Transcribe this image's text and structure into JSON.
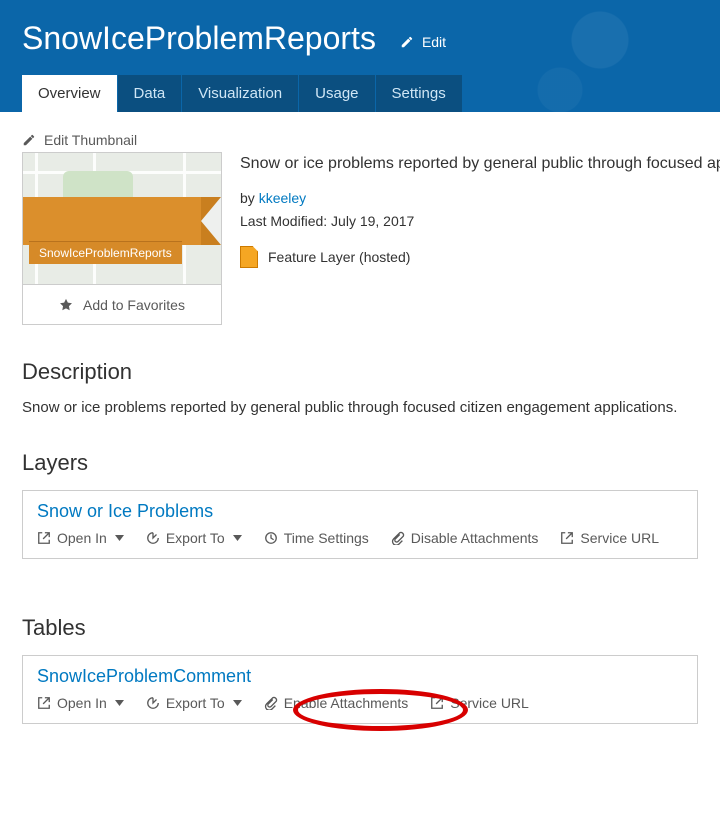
{
  "header": {
    "title": "SnowIceProblemReports",
    "edit_label": "Edit"
  },
  "tabs": [
    "Overview",
    "Data",
    "Visualization",
    "Usage",
    "Settings"
  ],
  "active_tab": "Overview",
  "thumbnail": {
    "edit_label": "Edit Thumbnail",
    "ribbon_text": "SnowIceProblemReports",
    "favorites_label": "Add to Favorites"
  },
  "summary": {
    "text": "Snow or ice problems reported by general public through focused applications.",
    "by_prefix": "by ",
    "author": "kkeeley",
    "last_modified_label": "Last Modified: July 19, 2017",
    "item_type": "Feature Layer (hosted)"
  },
  "description": {
    "heading": "Description",
    "body": "Snow or ice problems reported by general public through focused citizen engagement applications."
  },
  "layers": {
    "heading": "Layers",
    "items": [
      {
        "name": "Snow or Ice Problems",
        "actions": {
          "open_in": "Open In",
          "export_to": "Export To",
          "time_settings": "Time Settings",
          "attachments": "Disable Attachments",
          "service_url": "Service URL"
        }
      }
    ]
  },
  "tables": {
    "heading": "Tables",
    "items": [
      {
        "name": "SnowIceProblemComment",
        "actions": {
          "open_in": "Open In",
          "export_to": "Export To",
          "attachments": "Enable Attachments",
          "service_url": "Service URL"
        }
      }
    ]
  }
}
